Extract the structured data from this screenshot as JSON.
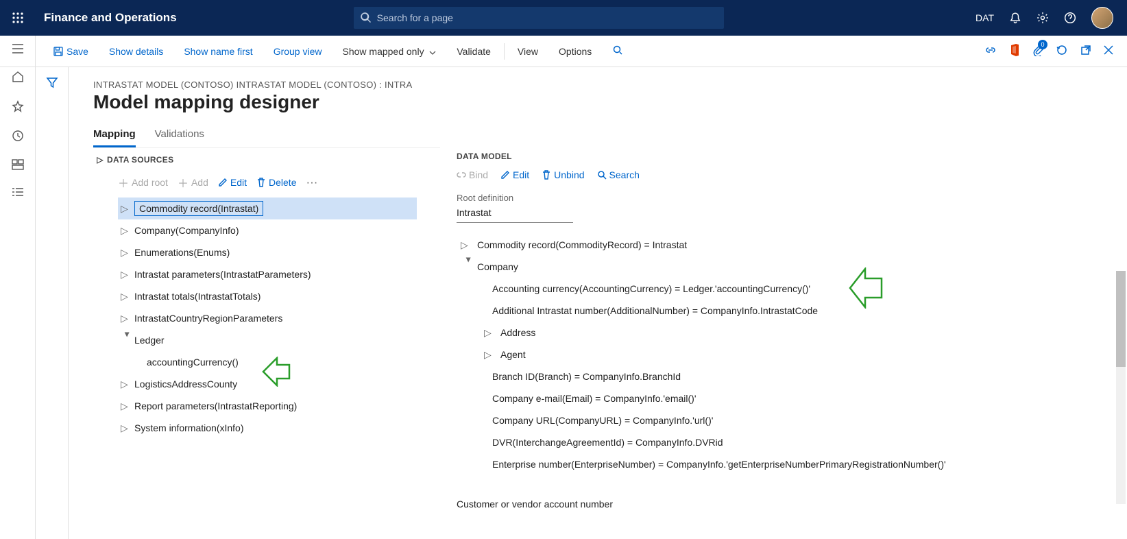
{
  "header": {
    "appTitle": "Finance and Operations",
    "searchPlaceholder": "Search for a page",
    "companyCode": "DAT"
  },
  "commandBar": {
    "save": "Save",
    "showDetails": "Show details",
    "showNameFirst": "Show name first",
    "groupView": "Group view",
    "showMappedOnly": "Show mapped only",
    "validate": "Validate",
    "view": "View",
    "options": "Options",
    "badgeCount": "0"
  },
  "page": {
    "breadcrumb": "INTRASTAT MODEL (CONTOSO) INTRASTAT MODEL (CONTOSO) : INTRA",
    "title": "Model mapping designer"
  },
  "tabs": {
    "mapping": "Mapping",
    "validations": "Validations"
  },
  "dataSources": {
    "header": "DATA SOURCES",
    "addRoot": "Add root",
    "add": "Add",
    "edit": "Edit",
    "delete": "Delete",
    "items": [
      "Commodity record(Intrastat)",
      "Company(CompanyInfo)",
      "Enumerations(Enums)",
      "Intrastat parameters(IntrastatParameters)",
      "Intrastat totals(IntrastatTotals)",
      "IntrastatCountryRegionParameters",
      "Ledger",
      "accountingCurrency()",
      "LogisticsAddressCounty",
      "Report parameters(IntrastatReporting)",
      "System information(xInfo)"
    ]
  },
  "dataModel": {
    "header": "DATA MODEL",
    "bind": "Bind",
    "edit": "Edit",
    "unbind": "Unbind",
    "search": "Search",
    "rootDefLabel": "Root definition",
    "rootDefValue": "Intrastat",
    "items": [
      "Commodity record(CommodityRecord) = Intrastat",
      "Company",
      "Accounting currency(AccountingCurrency) = Ledger.'accountingCurrency()'",
      "Additional Intrastat number(AdditionalNumber) = CompanyInfo.IntrastatCode",
      "Address",
      "Agent",
      "Branch ID(Branch) = CompanyInfo.BranchId",
      "Company e-mail(Email) = CompanyInfo.'email()'",
      "Company URL(CompanyURL) = CompanyInfo.'url()'",
      "DVR(InterchangeAgreementId) = CompanyInfo.DVRid",
      "Enterprise number(EnterpriseNumber) = CompanyInfo.'getEnterpriseNumberPrimaryRegistrationNumber()'"
    ],
    "footer": "Customer or vendor account number"
  }
}
